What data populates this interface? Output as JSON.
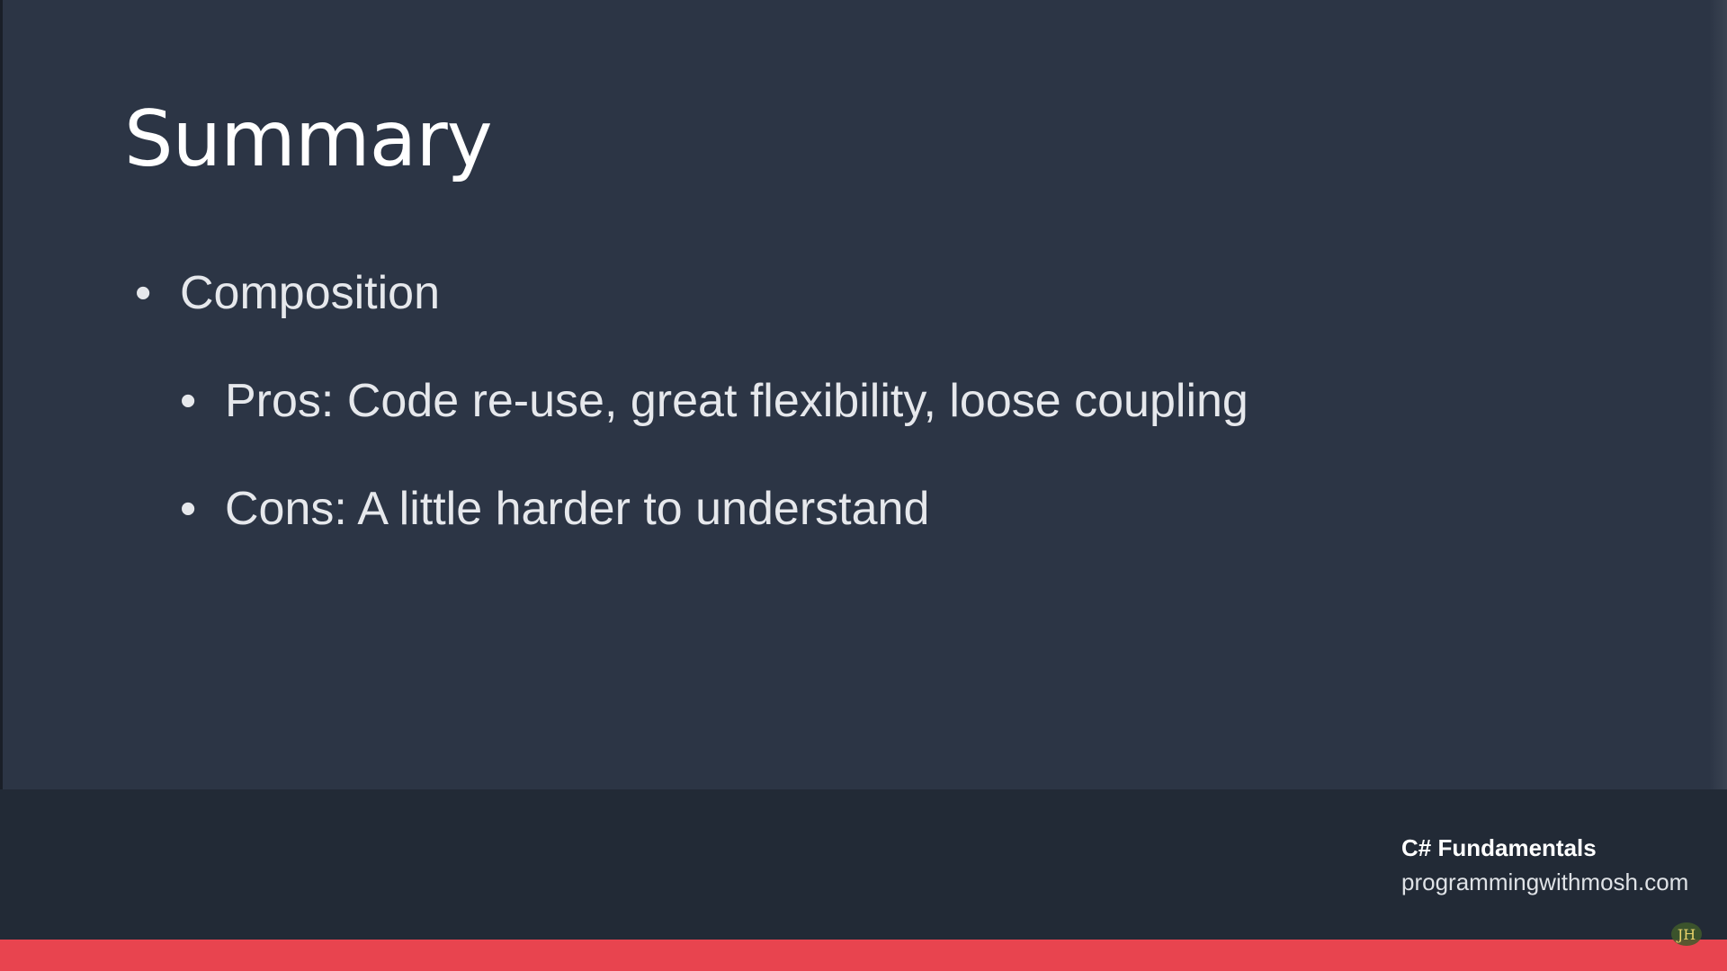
{
  "slide": {
    "title": "Summary",
    "bullets": [
      {
        "dot": "•",
        "text": "Composition"
      },
      {
        "dot": "•",
        "text": "Pros: Code re-use, great flexibility, loose coupling"
      },
      {
        "dot": "•",
        "text": "Cons: A little harder to understand"
      }
    ]
  },
  "footer": {
    "course": "C# Fundamentals",
    "site": "programmingwithmosh.com",
    "watermark": "JH"
  },
  "colors": {
    "background": "#2c3545",
    "footer": "#222a36",
    "accent": "#e8444f",
    "text": "#ffffff"
  }
}
